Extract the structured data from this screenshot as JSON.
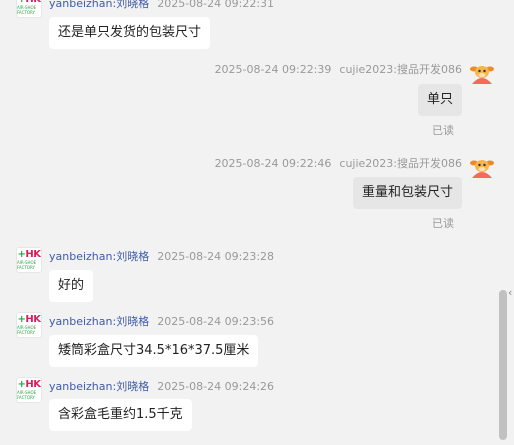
{
  "messages": [
    {
      "side": "left",
      "text": "还是单只发货的包装尺寸"
    },
    {
      "side": "right",
      "sender": "cujie2023:搜品开发086",
      "time": "2025-08-24 09:22:39",
      "text": "单只",
      "status": "已读"
    },
    {
      "side": "right",
      "sender": "cujie2023:搜品开发086",
      "time": "2025-08-24 09:22:46",
      "text": "重量和包装尺寸",
      "status": "已读"
    },
    {
      "side": "left",
      "sender": "yanbeizhan:刘晓格",
      "time": "2025-08-24 09:23:28",
      "text": "好的"
    },
    {
      "side": "left",
      "sender": "yanbeizhan:刘晓格",
      "time": "2025-08-24 09:23:56",
      "text": "矮筒彩盒尺寸34.5*16*37.5厘米"
    },
    {
      "side": "left",
      "sender": "yanbeizhan:刘晓格",
      "time": "2025-08-24 09:24:26",
      "text": "含彩盒毛重约1.5千克"
    }
  ],
  "top_partial": {
    "sender": "yanbeizhan:刘晓格",
    "time": "2025-08-24 09:22:31"
  },
  "avatars": {
    "left_logo": "HK",
    "left_logo_sub": "AIR-SHOE FACTORY",
    "left_icon": "brand-logo-icon",
    "right_icon": "cartoon-cow-icon"
  },
  "colors": {
    "accent_name": "#3f5ba9",
    "bubble_mine": "#e6e6e6",
    "bubble_theirs": "#ffffff",
    "background": "#f2f2f2"
  }
}
